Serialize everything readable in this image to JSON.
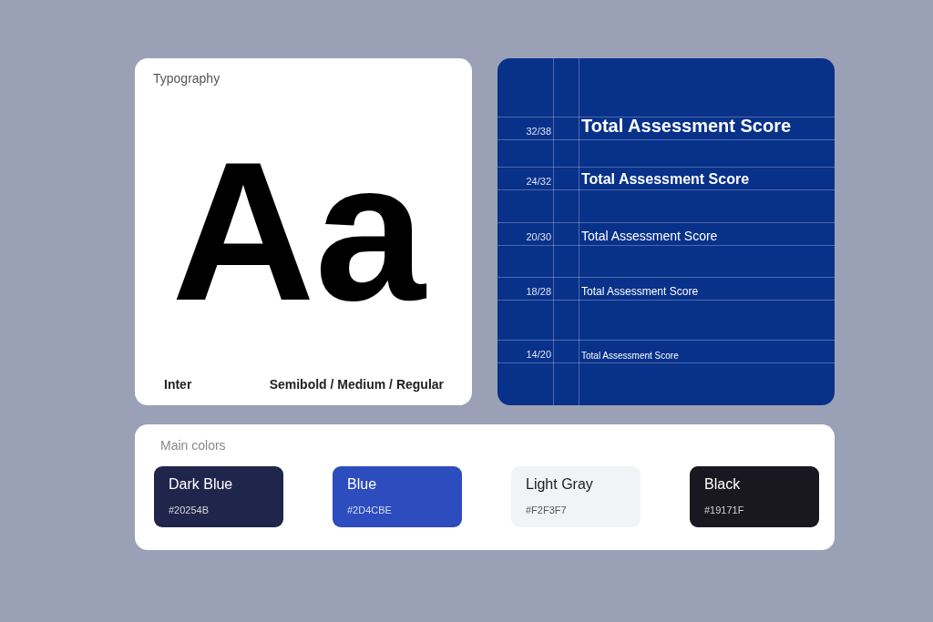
{
  "typography": {
    "title": "Typography",
    "sample": "Aa",
    "font_name": "Inter",
    "weights": "Semibold / Medium / Regular"
  },
  "type_scale": [
    {
      "size": "32/38",
      "label": "Total Assessment Score"
    },
    {
      "size": "24/32",
      "label": "Total Assessment Score"
    },
    {
      "size": "20/30",
      "label": "Total Assessment Score"
    },
    {
      "size": "18/28",
      "label": "Total Assessment Score"
    },
    {
      "size": "14/20",
      "label": "Total Assessment Score"
    }
  ],
  "colors": {
    "title": "Main colors",
    "swatches": [
      {
        "name": "Dark Blue",
        "hex": "#20254B",
        "color": "#20254b"
      },
      {
        "name": "Blue",
        "hex": "#2D4CBE",
        "color": "#2d4cbe"
      },
      {
        "name": "Light Gray",
        "hex": "#F2F3F7",
        "color": "#f2f3f7"
      },
      {
        "name": "Black",
        "hex": "#19171F",
        "color": "#19171f"
      }
    ]
  }
}
